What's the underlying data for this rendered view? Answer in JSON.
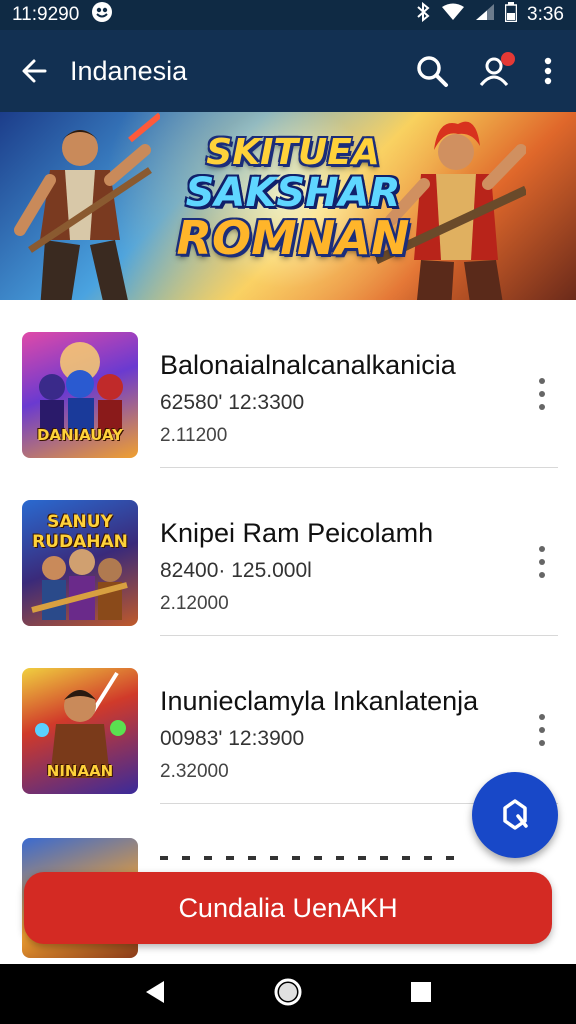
{
  "status_bar": {
    "time_left": "11:9290",
    "time_right": "3:36"
  },
  "app_bar": {
    "title": "Indanesia",
    "icons": [
      "back-arrow-icon",
      "search-icon",
      "account-icon",
      "more-vert-icon"
    ],
    "notification_dot_color": "#e53935"
  },
  "banner": {
    "line1": "SKITUEA",
    "line2": "SAKSHAR",
    "line3": "ROMNAN"
  },
  "list": [
    {
      "title": "Balonaialnalcanalkanicia",
      "meta": "62580' 12:3300",
      "sub": "2.11200",
      "thumb_label": "DANIAUAY"
    },
    {
      "title": "Knipei Ram Peicolamh",
      "meta": "82400· 125.000l",
      "sub": "2.12000",
      "thumb_label": "SANUY RUDAHAN"
    },
    {
      "title": "Inunieclamyla Inkanlatenja",
      "meta": "00983' 12:3900",
      "sub": "2.32000",
      "thumb_label": "NINAAN"
    }
  ],
  "cta": {
    "label": "Cundalia UenAKH"
  },
  "colors": {
    "app_bar": "#123052",
    "status_bar": "#0f2a44",
    "fab": "#1848c8",
    "cta": "#d42a23"
  }
}
